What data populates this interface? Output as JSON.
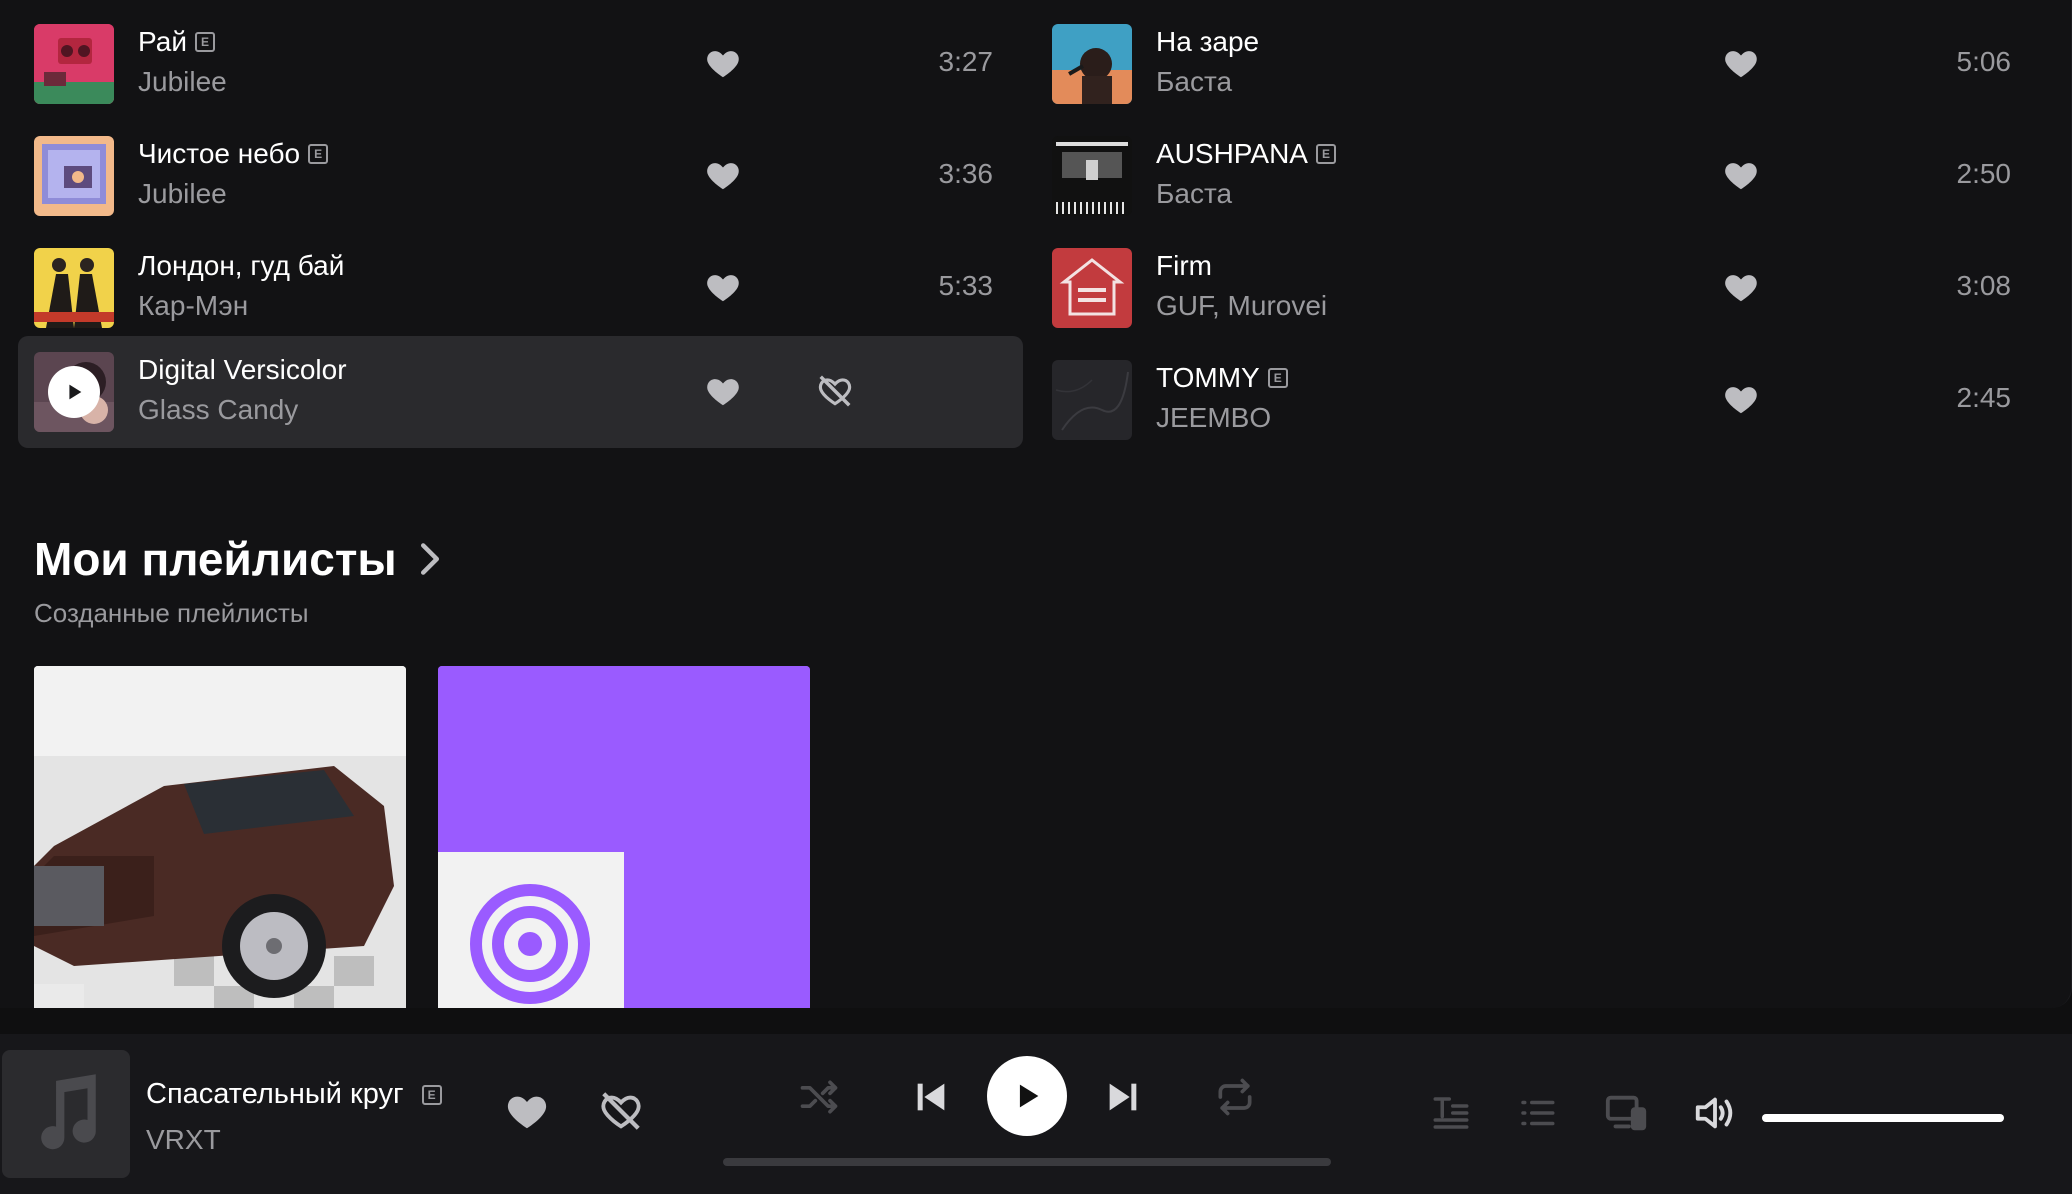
{
  "tracks_left": [
    {
      "title": "Рай",
      "artist": "Jubilee",
      "duration": "3:27",
      "explicit": true
    },
    {
      "title": "Чистое небо",
      "artist": "Jubilee",
      "duration": "3:36",
      "explicit": true
    },
    {
      "title": "Лондон, гуд бай",
      "artist": "Кар-Мэн",
      "duration": "5:33",
      "explicit": false
    },
    {
      "title": "Digital Versicolor",
      "artist": "Glass Candy",
      "duration": "",
      "explicit": false
    }
  ],
  "tracks_right": [
    {
      "title": "На заре",
      "artist": "Баста",
      "duration": "5:06",
      "explicit": false
    },
    {
      "title": "AUSHPANA",
      "artist": "Баста",
      "duration": "2:50",
      "explicit": true
    },
    {
      "title": "Firm",
      "artist": "GUF, Murovei",
      "duration": "3:08",
      "explicit": false
    },
    {
      "title": "TOMMY",
      "artist": "JEEMBO",
      "duration": "2:45",
      "explicit": true
    }
  ],
  "explicit_mark": "E",
  "playlists": {
    "title": "Мои плейлисты",
    "subtitle": "Созданные плейлисты"
  },
  "player": {
    "title": "Спасательный круг",
    "artist": "VRXT",
    "explicit": true,
    "volume": 1.0,
    "progress": 0.0
  },
  "icons": {
    "like": "heart-icon",
    "dislike": "heart-crossed-icon",
    "shuffle": "shuffle-icon",
    "prev": "previous-track-icon",
    "play": "play-icon",
    "next": "next-track-icon",
    "repeat": "repeat-icon",
    "lyrics": "lyrics-icon",
    "queue": "queue-icon",
    "devices": "devices-icon",
    "volume": "volume-icon",
    "chevron": "chevron-right-icon",
    "note": "music-note-icon"
  },
  "colors": {
    "background": "#121214",
    "accent_purple": "#9a5bff",
    "text_primary": "#ffffff",
    "text_secondary": "#9a9a9e",
    "hover_row": "#2a2a2d"
  }
}
